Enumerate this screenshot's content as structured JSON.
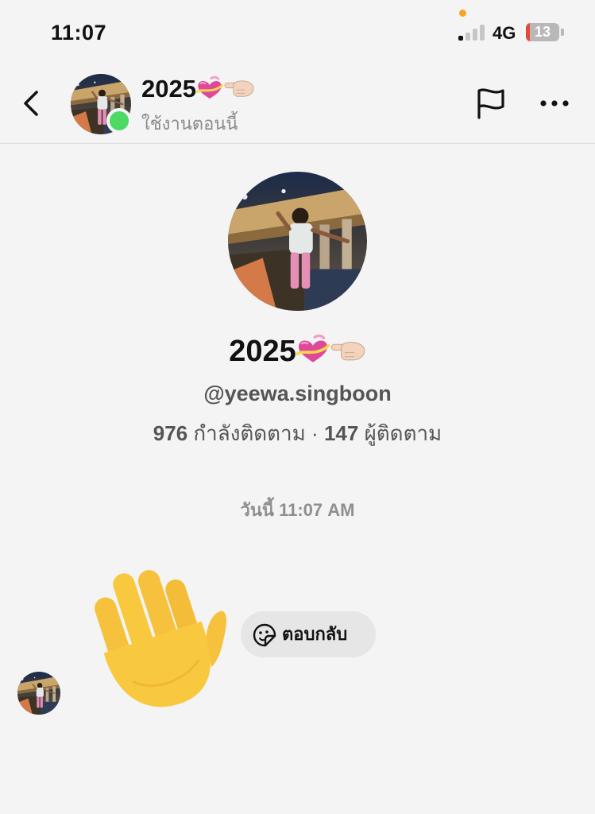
{
  "status_bar": {
    "time": "11:07",
    "network": "4G",
    "battery": "13",
    "battery_fraction": 0.13
  },
  "header": {
    "back_icon": "chevron-left-icon",
    "name": "2025",
    "name_emoji": [
      "heart-ribbon-emoji",
      "pointing-left-emoji"
    ],
    "status": "ใช้งานตอนนี้",
    "online_color": "#4cd964",
    "flag_icon": "flag-icon",
    "more_icon": "more-horizontal-icon"
  },
  "profile": {
    "name": "2025",
    "handle": "@yeewa.singboon",
    "following_count": "976",
    "following_label": "กำลังติดตาม",
    "separator": "·",
    "followers_count": "147",
    "followers_label": "ผู้ติดตาม"
  },
  "conversation": {
    "timestamp": "วันนี้ 11:07 AM",
    "message_emoji": "waving-hand-emoji",
    "reply_icon": "sticker-face-icon",
    "reply_label": "ตอบกลับ"
  },
  "colors": {
    "background": "#f4f4f4",
    "online": "#4cd964",
    "battery_low": "#e5483d",
    "privacy_dot": "#f5a623"
  }
}
